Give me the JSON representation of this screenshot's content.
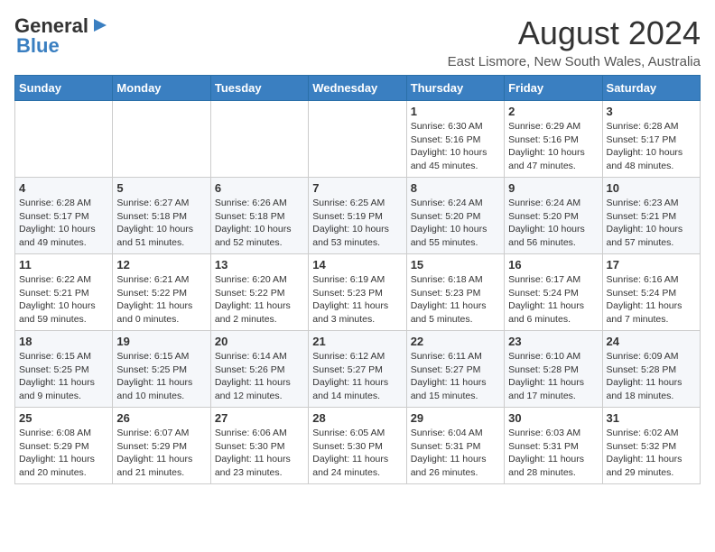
{
  "logo": {
    "part1": "General",
    "part2": "Blue"
  },
  "header": {
    "month": "August 2024",
    "location": "East Lismore, New South Wales, Australia"
  },
  "weekdays": [
    "Sunday",
    "Monday",
    "Tuesday",
    "Wednesday",
    "Thursday",
    "Friday",
    "Saturday"
  ],
  "weeks": [
    [
      {
        "day": "",
        "info": ""
      },
      {
        "day": "",
        "info": ""
      },
      {
        "day": "",
        "info": ""
      },
      {
        "day": "",
        "info": ""
      },
      {
        "day": "1",
        "info": "Sunrise: 6:30 AM\nSunset: 5:16 PM\nDaylight: 10 hours\nand 45 minutes."
      },
      {
        "day": "2",
        "info": "Sunrise: 6:29 AM\nSunset: 5:16 PM\nDaylight: 10 hours\nand 47 minutes."
      },
      {
        "day": "3",
        "info": "Sunrise: 6:28 AM\nSunset: 5:17 PM\nDaylight: 10 hours\nand 48 minutes."
      }
    ],
    [
      {
        "day": "4",
        "info": "Sunrise: 6:28 AM\nSunset: 5:17 PM\nDaylight: 10 hours\nand 49 minutes."
      },
      {
        "day": "5",
        "info": "Sunrise: 6:27 AM\nSunset: 5:18 PM\nDaylight: 10 hours\nand 51 minutes."
      },
      {
        "day": "6",
        "info": "Sunrise: 6:26 AM\nSunset: 5:18 PM\nDaylight: 10 hours\nand 52 minutes."
      },
      {
        "day": "7",
        "info": "Sunrise: 6:25 AM\nSunset: 5:19 PM\nDaylight: 10 hours\nand 53 minutes."
      },
      {
        "day": "8",
        "info": "Sunrise: 6:24 AM\nSunset: 5:20 PM\nDaylight: 10 hours\nand 55 minutes."
      },
      {
        "day": "9",
        "info": "Sunrise: 6:24 AM\nSunset: 5:20 PM\nDaylight: 10 hours\nand 56 minutes."
      },
      {
        "day": "10",
        "info": "Sunrise: 6:23 AM\nSunset: 5:21 PM\nDaylight: 10 hours\nand 57 minutes."
      }
    ],
    [
      {
        "day": "11",
        "info": "Sunrise: 6:22 AM\nSunset: 5:21 PM\nDaylight: 10 hours\nand 59 minutes."
      },
      {
        "day": "12",
        "info": "Sunrise: 6:21 AM\nSunset: 5:22 PM\nDaylight: 11 hours\nand 0 minutes."
      },
      {
        "day": "13",
        "info": "Sunrise: 6:20 AM\nSunset: 5:22 PM\nDaylight: 11 hours\nand 2 minutes."
      },
      {
        "day": "14",
        "info": "Sunrise: 6:19 AM\nSunset: 5:23 PM\nDaylight: 11 hours\nand 3 minutes."
      },
      {
        "day": "15",
        "info": "Sunrise: 6:18 AM\nSunset: 5:23 PM\nDaylight: 11 hours\nand 5 minutes."
      },
      {
        "day": "16",
        "info": "Sunrise: 6:17 AM\nSunset: 5:24 PM\nDaylight: 11 hours\nand 6 minutes."
      },
      {
        "day": "17",
        "info": "Sunrise: 6:16 AM\nSunset: 5:24 PM\nDaylight: 11 hours\nand 7 minutes."
      }
    ],
    [
      {
        "day": "18",
        "info": "Sunrise: 6:15 AM\nSunset: 5:25 PM\nDaylight: 11 hours\nand 9 minutes."
      },
      {
        "day": "19",
        "info": "Sunrise: 6:15 AM\nSunset: 5:25 PM\nDaylight: 11 hours\nand 10 minutes."
      },
      {
        "day": "20",
        "info": "Sunrise: 6:14 AM\nSunset: 5:26 PM\nDaylight: 11 hours\nand 12 minutes."
      },
      {
        "day": "21",
        "info": "Sunrise: 6:12 AM\nSunset: 5:27 PM\nDaylight: 11 hours\nand 14 minutes."
      },
      {
        "day": "22",
        "info": "Sunrise: 6:11 AM\nSunset: 5:27 PM\nDaylight: 11 hours\nand 15 minutes."
      },
      {
        "day": "23",
        "info": "Sunrise: 6:10 AM\nSunset: 5:28 PM\nDaylight: 11 hours\nand 17 minutes."
      },
      {
        "day": "24",
        "info": "Sunrise: 6:09 AM\nSunset: 5:28 PM\nDaylight: 11 hours\nand 18 minutes."
      }
    ],
    [
      {
        "day": "25",
        "info": "Sunrise: 6:08 AM\nSunset: 5:29 PM\nDaylight: 11 hours\nand 20 minutes."
      },
      {
        "day": "26",
        "info": "Sunrise: 6:07 AM\nSunset: 5:29 PM\nDaylight: 11 hours\nand 21 minutes."
      },
      {
        "day": "27",
        "info": "Sunrise: 6:06 AM\nSunset: 5:30 PM\nDaylight: 11 hours\nand 23 minutes."
      },
      {
        "day": "28",
        "info": "Sunrise: 6:05 AM\nSunset: 5:30 PM\nDaylight: 11 hours\nand 24 minutes."
      },
      {
        "day": "29",
        "info": "Sunrise: 6:04 AM\nSunset: 5:31 PM\nDaylight: 11 hours\nand 26 minutes."
      },
      {
        "day": "30",
        "info": "Sunrise: 6:03 AM\nSunset: 5:31 PM\nDaylight: 11 hours\nand 28 minutes."
      },
      {
        "day": "31",
        "info": "Sunrise: 6:02 AM\nSunset: 5:32 PM\nDaylight: 11 hours\nand 29 minutes."
      }
    ]
  ]
}
